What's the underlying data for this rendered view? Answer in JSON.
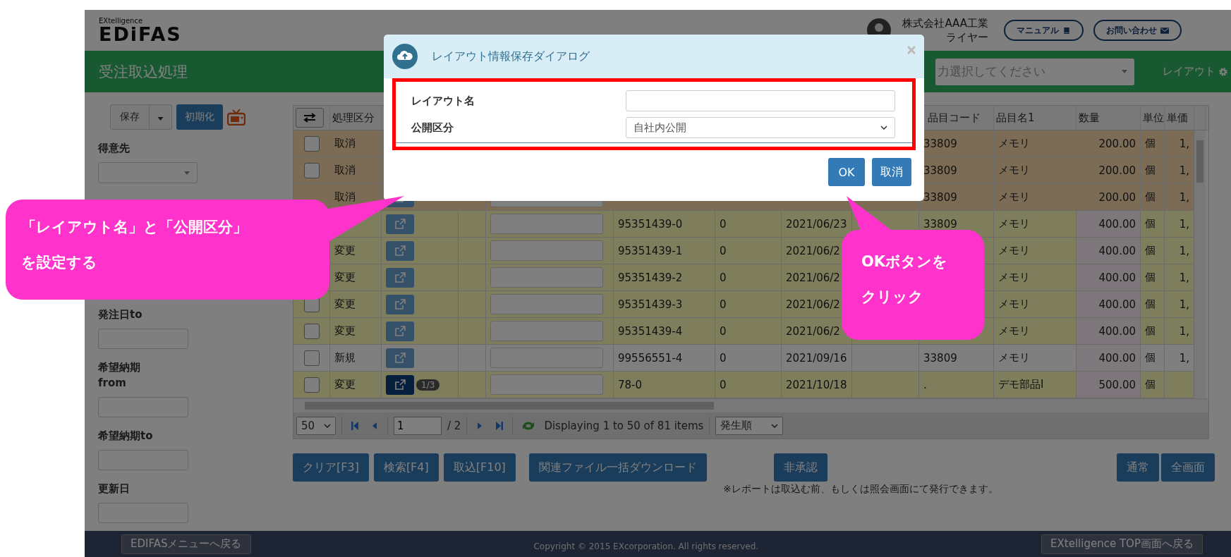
{
  "header": {
    "logo_small": "EXtelligence",
    "logo": "EDiFAS",
    "company": "株式会社AAA工業",
    "user": "ライヤー",
    "buttons": [
      {
        "label": "マニュアル"
      },
      {
        "label": "お問い合わせ"
      }
    ]
  },
  "title_bar": {
    "title": "受注取込処理",
    "select_text": "力選択してください",
    "layout_link": "レイアウト"
  },
  "sidebar": {
    "save": "保存",
    "reset": "初期化",
    "filters": [
      {
        "label": "得意先",
        "kind": "select"
      },
      {
        "label": "発注日to",
        "kind": "input"
      },
      {
        "label": "希望納期\nfrom",
        "kind": "input"
      },
      {
        "label": "希望納期to",
        "kind": "input"
      },
      {
        "label": "更新日",
        "kind": "input"
      }
    ]
  },
  "table": {
    "columns": {
      "kubun": "処理区分",
      "code": "品目コード",
      "name": "品目名1",
      "qty": "数量",
      "unit": "単位",
      "price": "単価"
    },
    "rows": [
      {
        "kind": "cancel",
        "checked": false,
        "kubun": "取消",
        "covered": true,
        "code": "33809",
        "name": "メモリ",
        "qty": "200.00",
        "unit": "個",
        "price": "1,"
      },
      {
        "kind": "cancel",
        "checked": false,
        "kubun": "取消",
        "covered": true,
        "code": "33809",
        "name": "メモリ",
        "qty": "200.00",
        "unit": "個",
        "price": "1,"
      },
      {
        "kind": "cancel",
        "kubun": "取消",
        "covered": false,
        "highlighted": false,
        "code": "33809",
        "name": "メモリ",
        "qty": "200.00",
        "unit": "個",
        "price": "1,"
      },
      {
        "kind": "change",
        "covered": false,
        "highlighted": false,
        "order_no": "95351439-0",
        "rev": "0",
        "date": "2021/06/23",
        "code": "33809",
        "name": "メモリ",
        "qty": "400.00",
        "unit": "個",
        "price": "1,"
      },
      {
        "kind": "change",
        "kubun": "変更",
        "covered": false,
        "highlighted": false,
        "order_no": "95351439-1",
        "rev": "0",
        "date": "2021/06/2",
        "name": "メモリ",
        "qty": "400.00",
        "unit": "個",
        "price": "1,"
      },
      {
        "kind": "change",
        "kubun": "変更",
        "covered": false,
        "highlighted": false,
        "order_no": "95351439-2",
        "rev": "0",
        "date": "2021/06/2",
        "name": "メモリ",
        "qty": "400.00",
        "unit": "個",
        "price": "1,"
      },
      {
        "kind": "change",
        "checked": false,
        "kubun": "変更",
        "covered": false,
        "highlighted": false,
        "order_no": "95351439-3",
        "rev": "0",
        "date": "2021/06/2",
        "name": "メモリ",
        "qty": "400.00",
        "unit": "個",
        "price": "1,"
      },
      {
        "kind": "change",
        "checked": false,
        "kubun": "変更",
        "covered": false,
        "highlighted": false,
        "order_no": "95351439-4",
        "rev": "0",
        "date": "2021/06/2",
        "name": "メモリ",
        "qty": "400.00",
        "unit": "個",
        "price": "1,"
      },
      {
        "kind": "new",
        "checked": false,
        "kubun": "新規",
        "covered": false,
        "highlighted": false,
        "order_no": "99556551-4",
        "rev": "0",
        "date": "2021/09/16",
        "code": "33809",
        "name": "メモリ",
        "qty": "400.00",
        "unit": "個",
        "price": "1,"
      },
      {
        "kind": "change",
        "checked": false,
        "kubun": "変更",
        "covered": false,
        "highlighted": true,
        "badge": "1/3",
        "order_no": "78-0",
        "rev": "0",
        "date": "2021/10/18",
        "code": ".",
        "name": "デモ部品I",
        "qty": "500.00",
        "unit": "個"
      }
    ]
  },
  "pager": {
    "page_size": "50",
    "page": "1",
    "pages": "/ 2",
    "info": "Displaying 1 to 50 of 81 items",
    "sort": "発生順"
  },
  "actions": [
    "クリア[F3]",
    "検索[F4]",
    "取込[F10]",
    "関連ファイル一括ダウンロード",
    "非承認",
    "通常",
    "全画面"
  ],
  "note": "※レポートは取込む前、もしくは照会画面にて発行できます。",
  "footer": {
    "back": "EDIFASメニューへ戻る",
    "copyright": "Copyright © 2015 EXcorporation. All rights reserved.",
    "top": "EXtelligence TOP画面へ戻る"
  },
  "dialog": {
    "title": "レイアウト情報保存ダイアログ",
    "fields": [
      {
        "label": "レイアウト名",
        "kind": "input"
      },
      {
        "label": "公開区分",
        "kind": "select",
        "value": "自社内公開"
      }
    ],
    "buttons": [
      "OK",
      "取消"
    ]
  },
  "callouts": [
    "「レイアウト名」と「公開区分」を設定する",
    "OKボタンをクリック"
  ]
}
